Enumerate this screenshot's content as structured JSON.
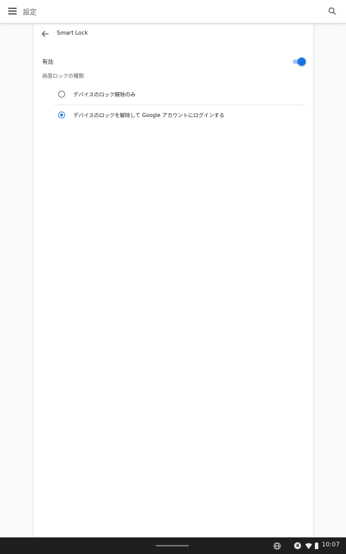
{
  "header": {
    "title": "設定",
    "menu_icon": "menu-icon",
    "search_icon": "search-icon"
  },
  "page": {
    "title": "Smart Lock",
    "back_icon": "back-arrow-icon"
  },
  "settings": {
    "enabled_label": "有効",
    "enabled": true,
    "screen_lock_type_label": "画面ロックの種類",
    "options": [
      {
        "label": "デバイスのロック解除のみ",
        "selected": false
      },
      {
        "label": "デバイスのロックを解除して Google アカウントにログインする",
        "selected": true
      }
    ]
  },
  "shelf": {
    "notification_count": "4",
    "time": "10:07",
    "icons": [
      "globe-icon",
      "wifi-icon",
      "battery-icon"
    ]
  },
  "colors": {
    "accent": "#1a73e8",
    "shelf_bg": "#1f1f1f"
  }
}
